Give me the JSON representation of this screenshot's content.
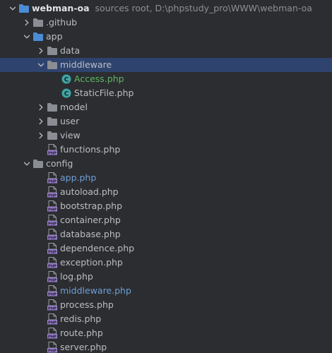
{
  "project": {
    "name": "webman-oa",
    "hint": "sources root,  D:\\phpstudy_pro\\WWW\\webman-oa"
  },
  "nodes": [
    {
      "label": ".github",
      "level": 1,
      "type": "folder",
      "expand": "closed",
      "style": "normal"
    },
    {
      "label": "app",
      "level": 1,
      "type": "folder-src",
      "expand": "open",
      "style": "normal"
    },
    {
      "label": "data",
      "level": 2,
      "type": "folder",
      "expand": "closed",
      "style": "normal"
    },
    {
      "label": "middleware",
      "level": 2,
      "type": "folder",
      "expand": "open",
      "style": "normal",
      "selected": true
    },
    {
      "label": "Access.php",
      "level": 3,
      "type": "class",
      "expand": "none",
      "style": "green"
    },
    {
      "label": "StaticFile.php",
      "level": 3,
      "type": "class",
      "expand": "none",
      "style": "normal"
    },
    {
      "label": "model",
      "level": 2,
      "type": "folder",
      "expand": "closed",
      "style": "normal"
    },
    {
      "label": "user",
      "level": 2,
      "type": "folder",
      "expand": "closed",
      "style": "normal"
    },
    {
      "label": "view",
      "level": 2,
      "type": "folder",
      "expand": "closed",
      "style": "normal"
    },
    {
      "label": "functions.php",
      "level": 2,
      "type": "php",
      "expand": "none",
      "style": "normal"
    },
    {
      "label": "config",
      "level": 1,
      "type": "folder",
      "expand": "open",
      "style": "normal"
    },
    {
      "label": "app.php",
      "level": 2,
      "type": "php",
      "expand": "none",
      "style": "blue"
    },
    {
      "label": "autoload.php",
      "level": 2,
      "type": "php",
      "expand": "none",
      "style": "normal"
    },
    {
      "label": "bootstrap.php",
      "level": 2,
      "type": "php",
      "expand": "none",
      "style": "normal"
    },
    {
      "label": "container.php",
      "level": 2,
      "type": "php",
      "expand": "none",
      "style": "normal"
    },
    {
      "label": "database.php",
      "level": 2,
      "type": "php",
      "expand": "none",
      "style": "normal"
    },
    {
      "label": "dependence.php",
      "level": 2,
      "type": "php",
      "expand": "none",
      "style": "normal"
    },
    {
      "label": "exception.php",
      "level": 2,
      "type": "php",
      "expand": "none",
      "style": "normal"
    },
    {
      "label": "log.php",
      "level": 2,
      "type": "php",
      "expand": "none",
      "style": "normal"
    },
    {
      "label": "middleware.php",
      "level": 2,
      "type": "php",
      "expand": "none",
      "style": "blue"
    },
    {
      "label": "process.php",
      "level": 2,
      "type": "php",
      "expand": "none",
      "style": "normal"
    },
    {
      "label": "redis.php",
      "level": 2,
      "type": "php",
      "expand": "none",
      "style": "normal"
    },
    {
      "label": "route.php",
      "level": 2,
      "type": "php",
      "expand": "none",
      "style": "normal"
    },
    {
      "label": "server.php",
      "level": 2,
      "type": "php",
      "expand": "none",
      "style": "normal"
    }
  ],
  "colors": {
    "background": "#2b2d30",
    "selection": "#2e436e",
    "folder": "#8a8d93",
    "source_folder": "#4a8cd6",
    "class_icon": "#3fa6a6",
    "php_icon": "#9b7fd4",
    "text": "#bcbec4",
    "modified_blue": "#6f9fd8",
    "added_green": "#5fb865"
  }
}
